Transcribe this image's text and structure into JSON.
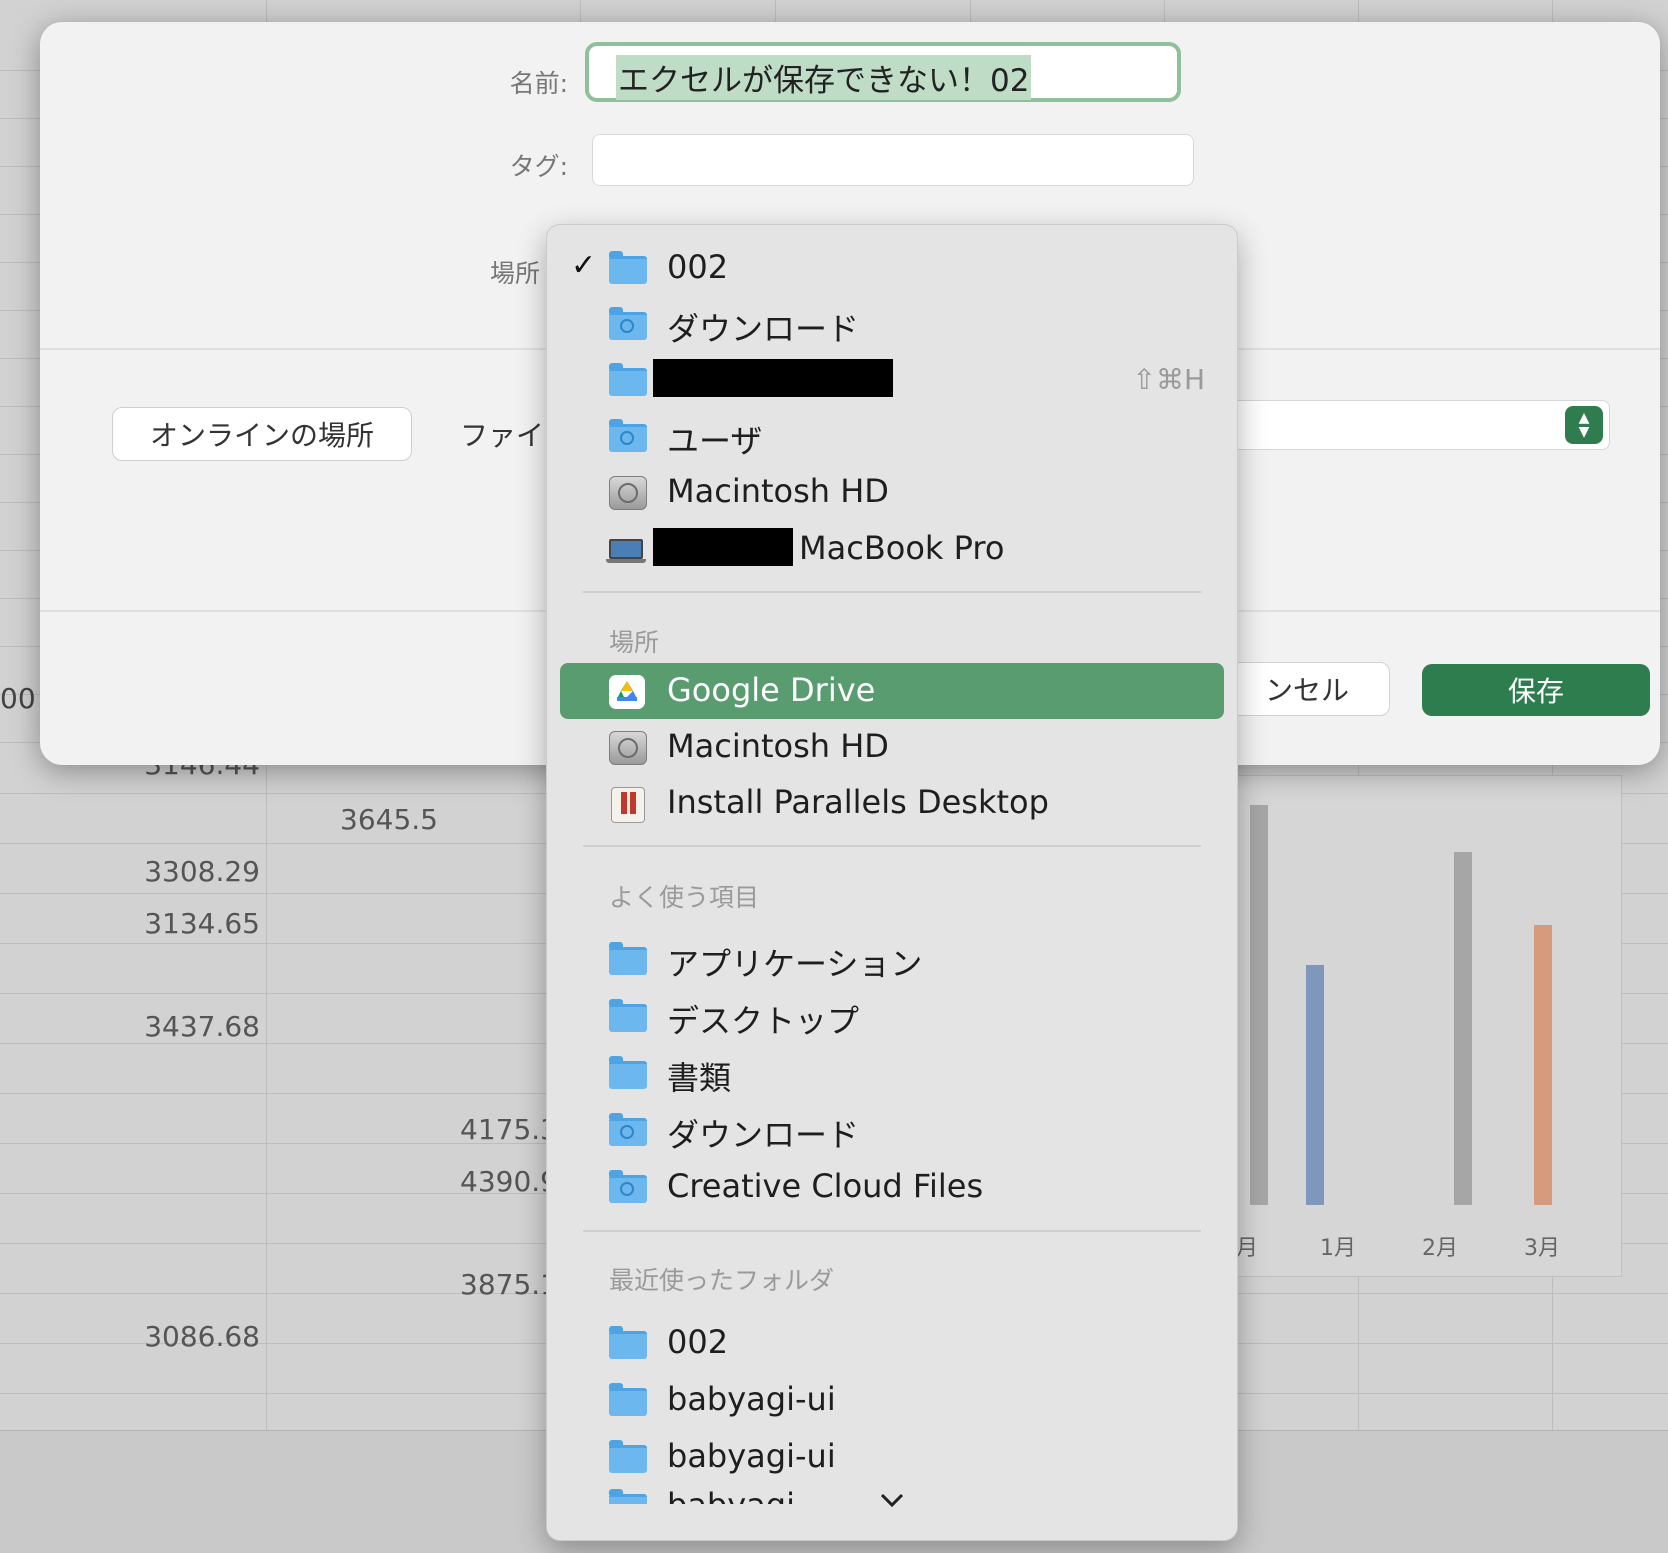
{
  "dialog": {
    "name_label": "名前:",
    "name_value": "エクセルが保存できない！02",
    "tag_label": "タグ:",
    "location_label_partial": "場所",
    "online_button": "オンラインの場所",
    "file_format_label_partial": "ファイ",
    "cancel_label_partial": "ンセル",
    "save_label": "保存"
  },
  "menu": {
    "top_items": [
      {
        "label": "002",
        "icon": "folder-icon",
        "checked": true
      },
      {
        "label": "ダウンロード",
        "icon": "downloads-folder-icon"
      },
      {
        "label": "",
        "icon": "home-folder-icon",
        "redacted": true,
        "shortcut": "⇧⌘H"
      },
      {
        "label": "ユーザ",
        "icon": "users-folder-icon"
      },
      {
        "label": "Macintosh HD",
        "icon": "hard-drive-icon"
      },
      {
        "label": "MacBook Pro",
        "icon": "laptop-icon",
        "redacted_prefix": true
      }
    ],
    "locations_header": "場所",
    "locations": [
      {
        "label": "Google Drive",
        "icon": "google-drive-icon",
        "selected": true
      },
      {
        "label": "Macintosh HD",
        "icon": "hard-drive-icon"
      },
      {
        "label": "Install Parallels Desktop",
        "icon": "parallels-installer-icon"
      }
    ],
    "favorites_header": "よく使う項目",
    "favorites": [
      {
        "label": "アプリケーション",
        "icon": "applications-folder-icon"
      },
      {
        "label": "デスクトップ",
        "icon": "desktop-folder-icon"
      },
      {
        "label": "書類",
        "icon": "documents-folder-icon"
      },
      {
        "label": "ダウンロード",
        "icon": "downloads-folder-icon"
      },
      {
        "label": "Creative Cloud Files",
        "icon": "creative-cloud-folder-icon"
      }
    ],
    "recent_header": "最近使ったフォルダ",
    "recent": [
      {
        "label": "002",
        "icon": "folder-icon"
      },
      {
        "label": "babyagi-ui",
        "icon": "folder-icon"
      },
      {
        "label": "babyagi-ui",
        "icon": "folder-icon"
      },
      {
        "label": "babyagi",
        "icon": "folder-icon",
        "clipped": true
      }
    ]
  },
  "background": {
    "cells": [
      "3146.44",
      "3645.5",
      "3308.29",
      "3134.65",
      "3437.68",
      "4175.3",
      "4390.9",
      "3875.1",
      "3086.68"
    ],
    "edge_text": "00",
    "chart_months": [
      "月",
      "1月",
      "2月",
      "3月"
    ],
    "colors": {
      "bar_gray": "#a6a6a6",
      "bar_blue": "#7f97bd",
      "bar_orange": "#d69a7c"
    }
  }
}
